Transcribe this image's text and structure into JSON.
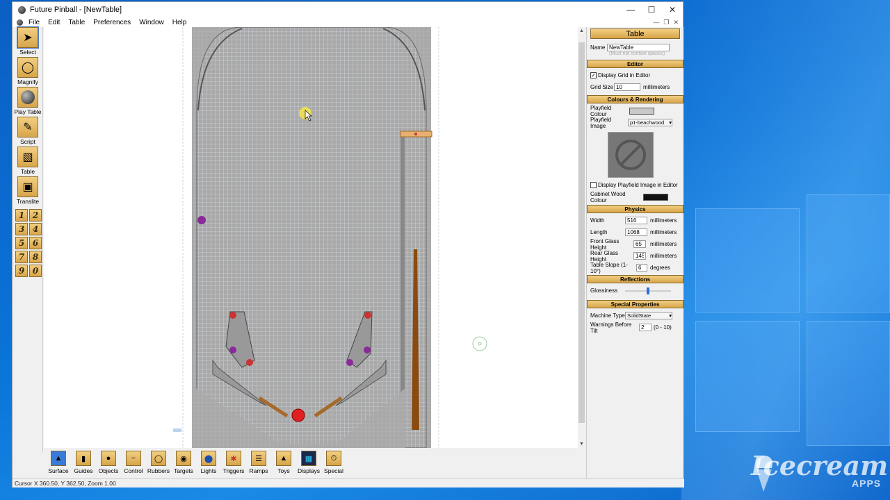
{
  "window": {
    "title": "Future Pinball - [NewTable]"
  },
  "menu": [
    "File",
    "Edit",
    "Table",
    "Preferences",
    "Window",
    "Help"
  ],
  "toolbox": [
    {
      "label": "Select",
      "icon": "cursor-icon"
    },
    {
      "label": "Magnify",
      "icon": "magnifier-icon"
    },
    {
      "label": "Play Table",
      "icon": "ball-icon"
    },
    {
      "label": "Script",
      "icon": "quill-icon"
    },
    {
      "label": "Table",
      "icon": "table-icon"
    },
    {
      "label": "Translite",
      "icon": "translite-icon"
    }
  ],
  "numpad": [
    "1",
    "2",
    "3",
    "4",
    "5",
    "6",
    "7",
    "8",
    "9",
    "0"
  ],
  "bottom_tools": [
    {
      "label": "Surface",
      "icon": "surface-icon"
    },
    {
      "label": "Guides",
      "icon": "guides-icon"
    },
    {
      "label": "Objects",
      "icon": "objects-icon"
    },
    {
      "label": "Control",
      "icon": "control-icon"
    },
    {
      "label": "Rubbers",
      "icon": "rubbers-icon"
    },
    {
      "label": "Targets",
      "icon": "targets-icon"
    },
    {
      "label": "Lights",
      "icon": "lights-icon"
    },
    {
      "label": "Triggers",
      "icon": "triggers-icon"
    },
    {
      "label": "Ramps",
      "icon": "ramps-icon"
    },
    {
      "label": "Toys",
      "icon": "toys-icon"
    },
    {
      "label": "Displays",
      "icon": "displays-icon"
    },
    {
      "label": "Special",
      "icon": "special-icon"
    }
  ],
  "status": "Cursor X 360.50, Y 362.50, Zoom 1.00",
  "panel": {
    "title": "Table",
    "name_label": "Name",
    "name_value": "NewTable",
    "name_hint": "(Must not contain spaces)",
    "editor": {
      "header": "Editor",
      "grid_label": "Display Grid in Editor",
      "grid_checked": true,
      "grid_size_label": "Grid Size",
      "grid_size_value": "10",
      "grid_size_unit": "millimeters"
    },
    "colours": {
      "header": "Colours & Rendering",
      "playfield_colour_label": "Playfield Colour",
      "playfield_colour": "#c8c8c8",
      "playfield_image_label": "Playfield Image",
      "playfield_image_value": "p1-beachwood",
      "display_image_label": "Display Playfield Image in Editor",
      "display_image_checked": false,
      "cabinet_label": "Cabinet Wood Colour",
      "cabinet_colour": "#111111"
    },
    "physics": {
      "header": "Physics",
      "rows": [
        {
          "label": "Width",
          "value": "516",
          "unit": "millimeters"
        },
        {
          "label": "Length",
          "value": "1068",
          "unit": "millimeters"
        },
        {
          "label": "Front Glass Height",
          "value": "65",
          "unit": "millimeters"
        },
        {
          "label": "Rear Glass Height",
          "value": "145",
          "unit": "millimeters"
        },
        {
          "label": "Table Slope (1-10°)",
          "value": "6",
          "unit": "degrees"
        }
      ]
    },
    "reflections": {
      "header": "Reflections",
      "glossiness_label": "Glossiness",
      "glossiness_level": 0.5
    },
    "special": {
      "header": "Special Properties",
      "machine_type_label": "Machine Type",
      "machine_type_value": "SolidState",
      "warnings_label": "Warnings Before Tilt",
      "warnings_value": "2",
      "warnings_range": "(0 - 10)"
    }
  },
  "watermark": {
    "brand": "Icecream",
    "sub": "APPS"
  }
}
